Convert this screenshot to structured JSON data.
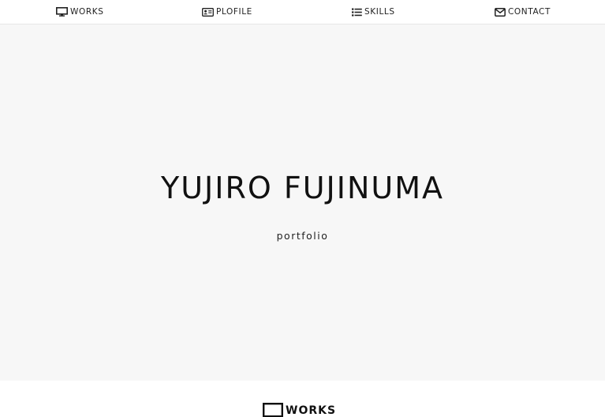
{
  "nav": {
    "items": [
      {
        "label": "WORKS",
        "icon": "monitor-icon"
      },
      {
        "label": "PLOFILE",
        "icon": "id-card-icon"
      },
      {
        "label": "SKILLS",
        "icon": "list-icon"
      },
      {
        "label": "CONTACT",
        "icon": "envelope-icon"
      }
    ]
  },
  "hero": {
    "title": "YUJIRO FUJINUMA",
    "subtitle": "portfolio"
  },
  "works_section": {
    "heading": "WORKS",
    "icon": "monitor-icon"
  },
  "colors": {
    "hero_background": "#f7f7f7",
    "text": "#111111",
    "nav_border": "#e6e6e6"
  }
}
